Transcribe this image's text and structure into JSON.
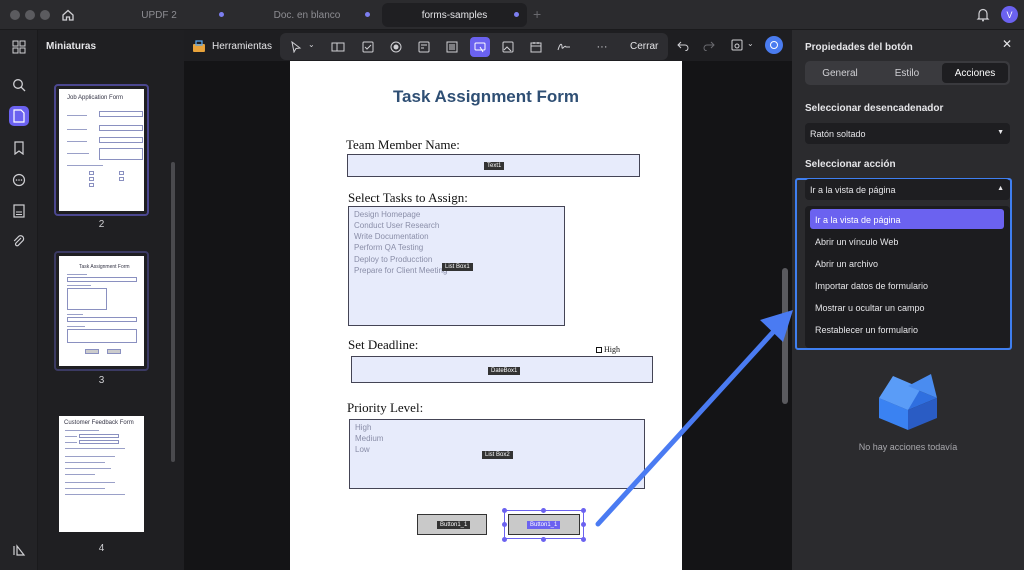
{
  "tabs": [
    {
      "label": "UPDF 2",
      "active": false
    },
    {
      "label": "Doc. en blanco",
      "active": false
    },
    {
      "label": "forms-samples",
      "active": true
    }
  ],
  "user_initial": "V",
  "thumbnails": {
    "title": "Miniaturas",
    "pages": [
      {
        "number": "2",
        "title": "Job Application Form"
      },
      {
        "number": "3",
        "title": "Task Assignment Form"
      },
      {
        "number": "4",
        "title": "Customer Feedback Form"
      }
    ]
  },
  "toolbar": {
    "tools_label": "Herramientas",
    "close_label": "Cerrar"
  },
  "document": {
    "title": "Task Assignment Form",
    "team_member_label": "Team Member Name:",
    "text_field_tag": "Text1",
    "tasks_label": "Select Tasks to Assign:",
    "task_items": [
      "Design Homepage",
      "Conduct User Research",
      "Write Documentation",
      "Perform QA Testing",
      "Deploy to Producction",
      "Prepare for Client Meeting"
    ],
    "list_box_tag": "List Box1",
    "deadline_label": "Set Deadline:",
    "high_checkbox_label": "High",
    "date_box_tag": "DateBox1",
    "priority_label": "Priority Level:",
    "priority_items": [
      "High",
      "Medium",
      "Low"
    ],
    "list_box2_tag": "List Box2",
    "button1_tag": "Button1_1",
    "button2_tag": "Button1_1"
  },
  "panel": {
    "title": "Propiedades del botón",
    "tabs": [
      {
        "label": "General",
        "active": false
      },
      {
        "label": "Estilo",
        "active": false
      },
      {
        "label": "Acciones",
        "active": true
      }
    ],
    "trigger_label": "Seleccionar desencadenador",
    "trigger_value": "Ratón soltado",
    "action_label": "Seleccionar acción",
    "action_value": "Ir a la vista de página",
    "action_options": [
      "Ir a la vista de página",
      "Abrir un vínculo Web",
      "Abrir un archivo",
      "Importar datos de formulario",
      "Mostrar u ocultar un campo",
      "Restablecer un formulario"
    ],
    "empty_text": "No hay acciones todavía"
  },
  "colors": {
    "accent": "#6b62f0",
    "highlight_border": "#3f7ff0",
    "doc_title": "#2f4f74",
    "field_fill": "#e7ebfb"
  }
}
